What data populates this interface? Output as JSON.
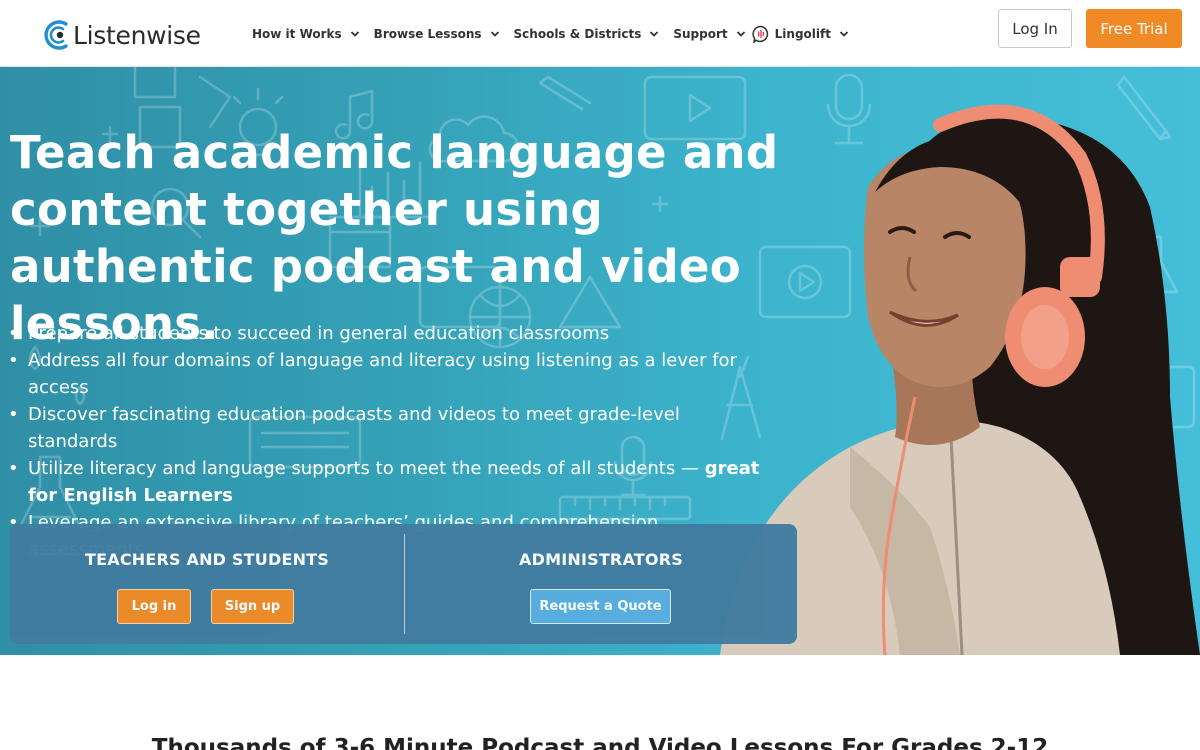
{
  "brand": {
    "name": "Listenwise"
  },
  "nav": {
    "items": [
      {
        "label": "How it Works"
      },
      {
        "label": "Browse Lessons"
      },
      {
        "label": "Schools & Districts"
      },
      {
        "label": "Support"
      },
      {
        "label": "Lingolift"
      }
    ],
    "login_label": "Log In",
    "trial_label": "Free Trial"
  },
  "hero": {
    "title": "Teach academic language and content together using authentic podcast and video lessons.",
    "bullets": [
      {
        "text": "Prepare all students to succeed in general education classrooms"
      },
      {
        "text": "Address all four domains of language and literacy using listening as a lever for access"
      },
      {
        "text": "Discover fascinating education podcasts and videos to meet grade-level standards"
      },
      {
        "text": "Utilize literacy and language supports to meet the needs of all students — ",
        "strong": "great for English Learners"
      },
      {
        "text": "Leverage an extensive library of teachers’ guides and comprehension assessments"
      }
    ]
  },
  "cta": {
    "teachers_title": "TEACHERS AND STUDENTS",
    "login_label": "Log in",
    "signup_label": "Sign up",
    "admin_title": "ADMINISTRATORS",
    "quote_label": "Request a Quote"
  },
  "section": {
    "title": "Thousands of 3-6 Minute Podcast and Video Lessons For Grades 2-12"
  },
  "colors": {
    "accent_orange": "#f08a24",
    "hero_teal": "#3cb3cc",
    "panel_blue": "#417ca0",
    "quote_blue": "#5aaee0",
    "logo_blue": "#1f8fd0"
  },
  "icons": {
    "logo": "listenwise-logo-icon",
    "dropdown": "chevron-down-icon",
    "lingolift": "lingolift-icon"
  }
}
